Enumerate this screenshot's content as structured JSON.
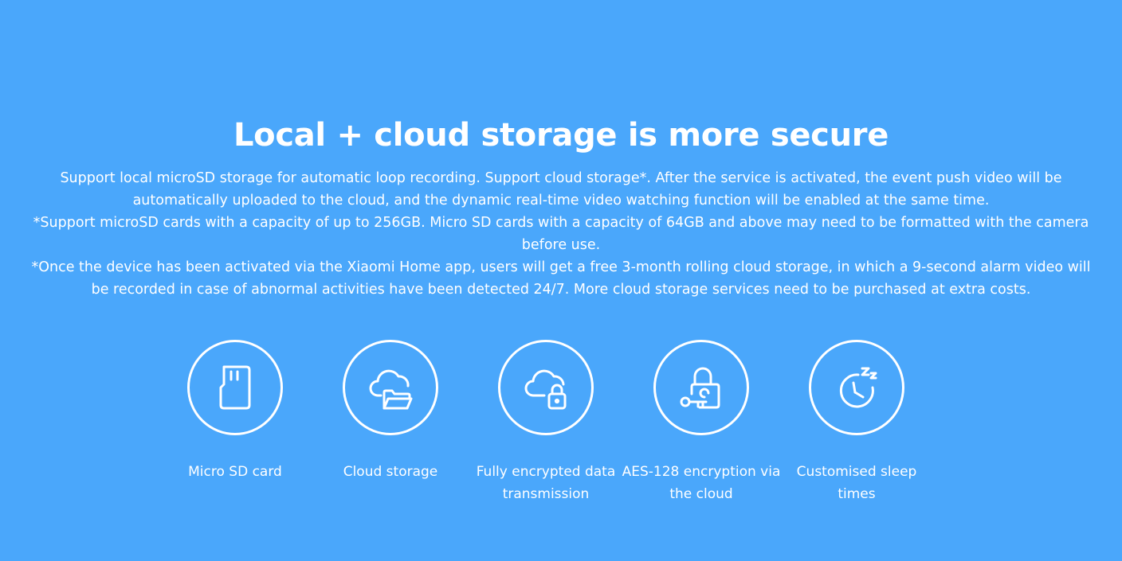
{
  "heading": "Local + cloud storage is more secure",
  "description": [
    "Support local microSD storage for automatic loop recording. Support cloud storage*. After the service is activated, the event push video will be automatically uploaded to the cloud, and the dynamic real-time video watching function will be enabled at the same time.",
    "*Support microSD cards with a capacity of up to 256GB. Micro SD cards with a capacity of 64GB and above may need to be formatted with the camera before use.",
    "*Once the device has been activated via the Xiaomi Home app, users will get a free 3-month rolling cloud storage, in which a 9-second  alarm video will be recorded in case of abnormal activities have been detected 24/7. More cloud storage services need to be purchased at extra costs."
  ],
  "features": [
    {
      "label": "Micro SD card",
      "icon": "sd-card-icon"
    },
    {
      "label": "Cloud storage",
      "icon": "cloud-folder-icon"
    },
    {
      "label": "Fully encrypted data transmission",
      "icon": "cloud-lock-icon"
    },
    {
      "label": "AES-128 encryption via the cloud",
      "icon": "lock-key-icon"
    },
    {
      "label": "Customised sleep times",
      "icon": "sleep-timer-icon"
    }
  ],
  "colors": {
    "background": "#4aa7fb",
    "foreground": "#ffffff"
  }
}
